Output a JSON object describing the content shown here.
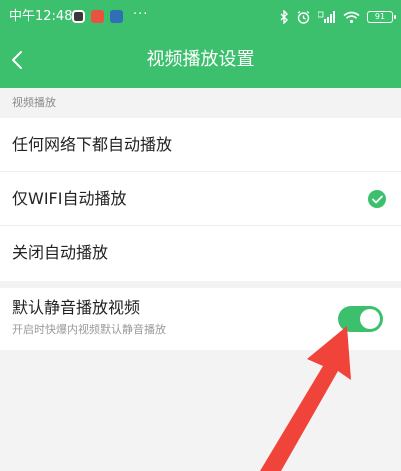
{
  "status_bar": {
    "time": "中午12:48",
    "more": "···",
    "battery": "91"
  },
  "nav": {
    "title": "视频播放设置"
  },
  "section": {
    "title": "视频播放"
  },
  "options": [
    {
      "label": "任何网络下都自动播放",
      "selected": false
    },
    {
      "label": "仅WIFI自动播放",
      "selected": true
    },
    {
      "label": "关闭自动播放",
      "selected": false
    }
  ],
  "mute": {
    "title": "默认静音播放视频",
    "description": "开启时快爆内视频默认静音播放",
    "enabled": true
  },
  "colors": {
    "accent": "#3cc06e",
    "annotation": "#f0433a"
  }
}
